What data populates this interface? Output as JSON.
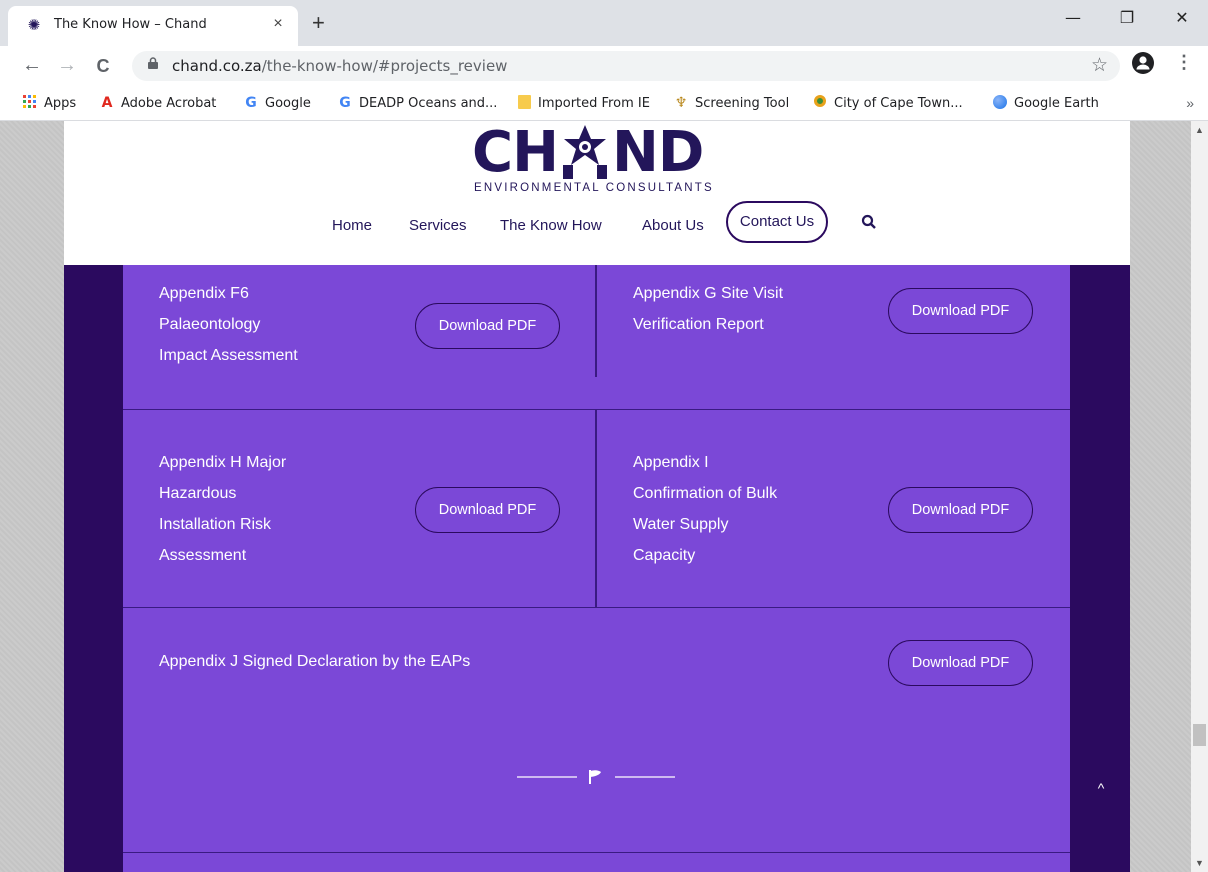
{
  "browser": {
    "tab_title": "The Know How – Chand",
    "tab_close": "×",
    "new_tab": "+",
    "window": {
      "minimize": "—",
      "restore": "❐",
      "close": "✕"
    },
    "nav": {
      "back": "←",
      "forward": "→",
      "reload": "C"
    },
    "url_domain": "chand.co.za",
    "url_path": "/the-know-how/#projects_review",
    "star": "☆",
    "menu_kebab": "⋮",
    "bookmarks": [
      {
        "label": "Apps",
        "icon": "apps-grid-icon"
      },
      {
        "label": "Adobe Acrobat",
        "icon": "acrobat-icon"
      },
      {
        "label": "Google",
        "icon": "google-icon"
      },
      {
        "label": "DEADP Oceans and...",
        "icon": "google-icon"
      },
      {
        "label": "Imported From IE",
        "icon": "folder-icon"
      },
      {
        "label": "Screening Tool",
        "icon": "sa-coat-of-arms-icon"
      },
      {
        "label": "City of Cape Town...",
        "icon": "cape-town-icon"
      },
      {
        "label": "Google Earth",
        "icon": "google-earth-icon"
      }
    ],
    "bookmarks_more": "»"
  },
  "site": {
    "logo_word_a": "CH",
    "logo_word_b": "ND",
    "logo_tagline": "ENVIRONMENTAL CONSULTANTS",
    "menu": [
      "Home",
      "Services",
      "The Know How",
      "About Us"
    ],
    "contact": "Contact Us"
  },
  "documents": [
    {
      "title": "Appendix F6\nPalaeontology\nImpact Assessment",
      "button": "Download PDF"
    },
    {
      "title": "Appendix G Site Visit\nVerification Report",
      "button": "Download PDF"
    },
    {
      "title": "Appendix H Major\nHazardous\nInstallation Risk\nAssessment",
      "button": "Download PDF"
    },
    {
      "title": "Appendix I\nConfirmation of Bulk\nWater Supply\nCapacity",
      "button": "Download PDF"
    },
    {
      "title": "Appendix J Signed Declaration by the EAPs",
      "button": "Download PDF"
    }
  ],
  "scroll_top": "^",
  "colors": {
    "brand": "#23165a",
    "panel": "#7b48d7",
    "dark": "#2b0a5f"
  }
}
